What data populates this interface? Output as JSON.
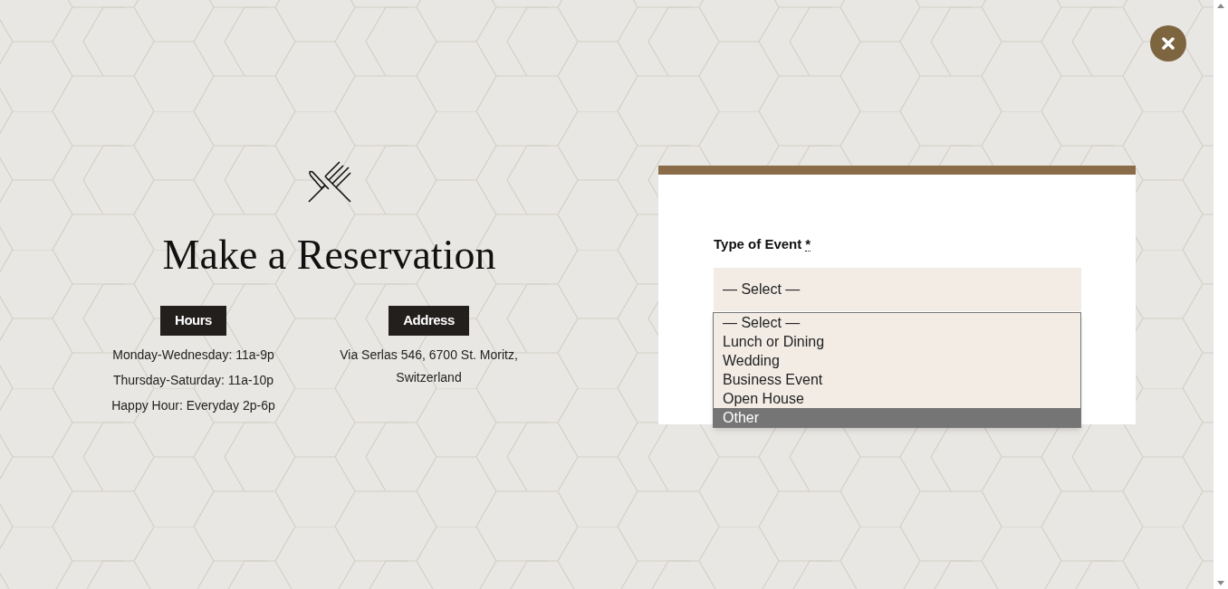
{
  "title": "Make a Reservation",
  "hours": {
    "heading": "Hours",
    "lines": [
      "Monday-Wednesday: 11a-9p",
      "Thursday-Saturday: 11a-10p",
      "Happy Hour: Everyday 2p-6p"
    ]
  },
  "address": {
    "heading": "Address",
    "lines": [
      "Via Serlas 546, 6700 St. Moritz,",
      "Switzerland"
    ]
  },
  "form": {
    "label": "Type of Event",
    "required_mark": "*",
    "select": {
      "value": "— Select —",
      "expanded": true,
      "options": [
        {
          "label": "— Select —",
          "highlighted": false
        },
        {
          "label": "Lunch or Dining",
          "highlighted": false
        },
        {
          "label": "Wedding",
          "highlighted": false
        },
        {
          "label": "Business Event",
          "highlighted": false
        },
        {
          "label": "Open House",
          "highlighted": false
        },
        {
          "label": "Other",
          "highlighted": true
        }
      ]
    }
  }
}
